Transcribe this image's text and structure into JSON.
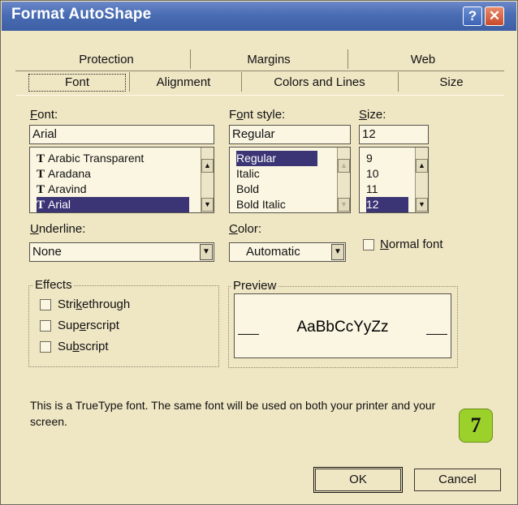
{
  "window": {
    "title": "Format AutoShape",
    "help": "?",
    "close": "✕"
  },
  "tabs": {
    "back": [
      "Protection",
      "Margins",
      "Web"
    ],
    "front": [
      "Font",
      "Alignment",
      "Colors and Lines",
      "Size"
    ]
  },
  "font": {
    "label": "Font:",
    "value": "Arial",
    "items": [
      "Arabic Transparent",
      "Aradana",
      "Aravind",
      "Arial"
    ],
    "selected_index": 3,
    "type_glyph": "T"
  },
  "font_style": {
    "label": "Font style:",
    "value": "Regular",
    "items": [
      "Regular",
      "Italic",
      "Bold",
      "Bold Italic"
    ],
    "selected_index": 0
  },
  "size": {
    "label": "Size:",
    "value": "12",
    "items": [
      "9",
      "10",
      "11",
      "12"
    ],
    "selected_index": 3
  },
  "underline": {
    "label": "Underline:",
    "value": "None"
  },
  "color": {
    "label": "Color:",
    "value": "Automatic"
  },
  "normal_font": {
    "label": "Normal font",
    "checked": false
  },
  "effects": {
    "label": "Effects",
    "items": [
      "Strikethrough",
      "Superscript",
      "Subscript"
    ]
  },
  "preview": {
    "label": "Preview",
    "sample": "AaBbCcYyZz"
  },
  "description": "This is a TrueType font.  The same font will be used on both your printer and your screen.",
  "badge": "7",
  "buttons": {
    "ok": "OK",
    "cancel": "Cancel"
  },
  "colors": {
    "title_bar": "#496cb3",
    "dialog_bg": "#efe6c4",
    "selection": "#3b3575",
    "badge": "#9bd12a",
    "close_button": "#c8492a"
  }
}
